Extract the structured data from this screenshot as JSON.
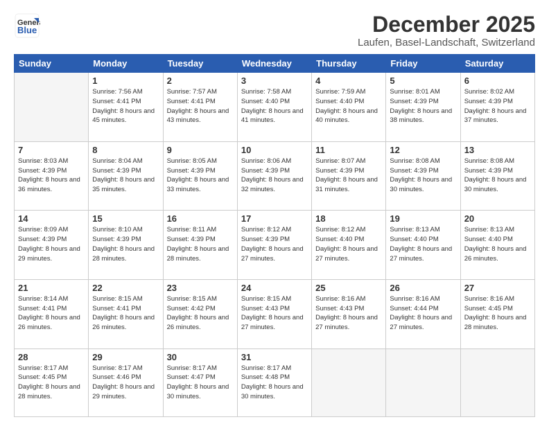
{
  "logo": {
    "general": "General",
    "blue": "Blue",
    "tagline": "GeneralBlue"
  },
  "header": {
    "month_year": "December 2025",
    "location": "Laufen, Basel-Landschaft, Switzerland"
  },
  "weekdays": [
    "Sunday",
    "Monday",
    "Tuesday",
    "Wednesday",
    "Thursday",
    "Friday",
    "Saturday"
  ],
  "weeks": [
    [
      {
        "date": "",
        "sunrise": "",
        "sunset": "",
        "daylight": ""
      },
      {
        "date": "1",
        "sunrise": "Sunrise: 7:56 AM",
        "sunset": "Sunset: 4:41 PM",
        "daylight": "Daylight: 8 hours and 45 minutes."
      },
      {
        "date": "2",
        "sunrise": "Sunrise: 7:57 AM",
        "sunset": "Sunset: 4:41 PM",
        "daylight": "Daylight: 8 hours and 43 minutes."
      },
      {
        "date": "3",
        "sunrise": "Sunrise: 7:58 AM",
        "sunset": "Sunset: 4:40 PM",
        "daylight": "Daylight: 8 hours and 41 minutes."
      },
      {
        "date": "4",
        "sunrise": "Sunrise: 7:59 AM",
        "sunset": "Sunset: 4:40 PM",
        "daylight": "Daylight: 8 hours and 40 minutes."
      },
      {
        "date": "5",
        "sunrise": "Sunrise: 8:01 AM",
        "sunset": "Sunset: 4:39 PM",
        "daylight": "Daylight: 8 hours and 38 minutes."
      },
      {
        "date": "6",
        "sunrise": "Sunrise: 8:02 AM",
        "sunset": "Sunset: 4:39 PM",
        "daylight": "Daylight: 8 hours and 37 minutes."
      }
    ],
    [
      {
        "date": "7",
        "sunrise": "Sunrise: 8:03 AM",
        "sunset": "Sunset: 4:39 PM",
        "daylight": "Daylight: 8 hours and 36 minutes."
      },
      {
        "date": "8",
        "sunrise": "Sunrise: 8:04 AM",
        "sunset": "Sunset: 4:39 PM",
        "daylight": "Daylight: 8 hours and 35 minutes."
      },
      {
        "date": "9",
        "sunrise": "Sunrise: 8:05 AM",
        "sunset": "Sunset: 4:39 PM",
        "daylight": "Daylight: 8 hours and 33 minutes."
      },
      {
        "date": "10",
        "sunrise": "Sunrise: 8:06 AM",
        "sunset": "Sunset: 4:39 PM",
        "daylight": "Daylight: 8 hours and 32 minutes."
      },
      {
        "date": "11",
        "sunrise": "Sunrise: 8:07 AM",
        "sunset": "Sunset: 4:39 PM",
        "daylight": "Daylight: 8 hours and 31 minutes."
      },
      {
        "date": "12",
        "sunrise": "Sunrise: 8:08 AM",
        "sunset": "Sunset: 4:39 PM",
        "daylight": "Daylight: 8 hours and 30 minutes."
      },
      {
        "date": "13",
        "sunrise": "Sunrise: 8:08 AM",
        "sunset": "Sunset: 4:39 PM",
        "daylight": "Daylight: 8 hours and 30 minutes."
      }
    ],
    [
      {
        "date": "14",
        "sunrise": "Sunrise: 8:09 AM",
        "sunset": "Sunset: 4:39 PM",
        "daylight": "Daylight: 8 hours and 29 minutes."
      },
      {
        "date": "15",
        "sunrise": "Sunrise: 8:10 AM",
        "sunset": "Sunset: 4:39 PM",
        "daylight": "Daylight: 8 hours and 28 minutes."
      },
      {
        "date": "16",
        "sunrise": "Sunrise: 8:11 AM",
        "sunset": "Sunset: 4:39 PM",
        "daylight": "Daylight: 8 hours and 28 minutes."
      },
      {
        "date": "17",
        "sunrise": "Sunrise: 8:12 AM",
        "sunset": "Sunset: 4:39 PM",
        "daylight": "Daylight: 8 hours and 27 minutes."
      },
      {
        "date": "18",
        "sunrise": "Sunrise: 8:12 AM",
        "sunset": "Sunset: 4:40 PM",
        "daylight": "Daylight: 8 hours and 27 minutes."
      },
      {
        "date": "19",
        "sunrise": "Sunrise: 8:13 AM",
        "sunset": "Sunset: 4:40 PM",
        "daylight": "Daylight: 8 hours and 27 minutes."
      },
      {
        "date": "20",
        "sunrise": "Sunrise: 8:13 AM",
        "sunset": "Sunset: 4:40 PM",
        "daylight": "Daylight: 8 hours and 26 minutes."
      }
    ],
    [
      {
        "date": "21",
        "sunrise": "Sunrise: 8:14 AM",
        "sunset": "Sunset: 4:41 PM",
        "daylight": "Daylight: 8 hours and 26 minutes."
      },
      {
        "date": "22",
        "sunrise": "Sunrise: 8:15 AM",
        "sunset": "Sunset: 4:41 PM",
        "daylight": "Daylight: 8 hours and 26 minutes."
      },
      {
        "date": "23",
        "sunrise": "Sunrise: 8:15 AM",
        "sunset": "Sunset: 4:42 PM",
        "daylight": "Daylight: 8 hours and 26 minutes."
      },
      {
        "date": "24",
        "sunrise": "Sunrise: 8:15 AM",
        "sunset": "Sunset: 4:43 PM",
        "daylight": "Daylight: 8 hours and 27 minutes."
      },
      {
        "date": "25",
        "sunrise": "Sunrise: 8:16 AM",
        "sunset": "Sunset: 4:43 PM",
        "daylight": "Daylight: 8 hours and 27 minutes."
      },
      {
        "date": "26",
        "sunrise": "Sunrise: 8:16 AM",
        "sunset": "Sunset: 4:44 PM",
        "daylight": "Daylight: 8 hours and 27 minutes."
      },
      {
        "date": "27",
        "sunrise": "Sunrise: 8:16 AM",
        "sunset": "Sunset: 4:45 PM",
        "daylight": "Daylight: 8 hours and 28 minutes."
      }
    ],
    [
      {
        "date": "28",
        "sunrise": "Sunrise: 8:17 AM",
        "sunset": "Sunset: 4:45 PM",
        "daylight": "Daylight: 8 hours and 28 minutes."
      },
      {
        "date": "29",
        "sunrise": "Sunrise: 8:17 AM",
        "sunset": "Sunset: 4:46 PM",
        "daylight": "Daylight: 8 hours and 29 minutes."
      },
      {
        "date": "30",
        "sunrise": "Sunrise: 8:17 AM",
        "sunset": "Sunset: 4:47 PM",
        "daylight": "Daylight: 8 hours and 30 minutes."
      },
      {
        "date": "31",
        "sunrise": "Sunrise: 8:17 AM",
        "sunset": "Sunset: 4:48 PM",
        "daylight": "Daylight: 8 hours and 30 minutes."
      },
      {
        "date": "",
        "sunrise": "",
        "sunset": "",
        "daylight": ""
      },
      {
        "date": "",
        "sunrise": "",
        "sunset": "",
        "daylight": ""
      },
      {
        "date": "",
        "sunrise": "",
        "sunset": "",
        "daylight": ""
      }
    ]
  ]
}
